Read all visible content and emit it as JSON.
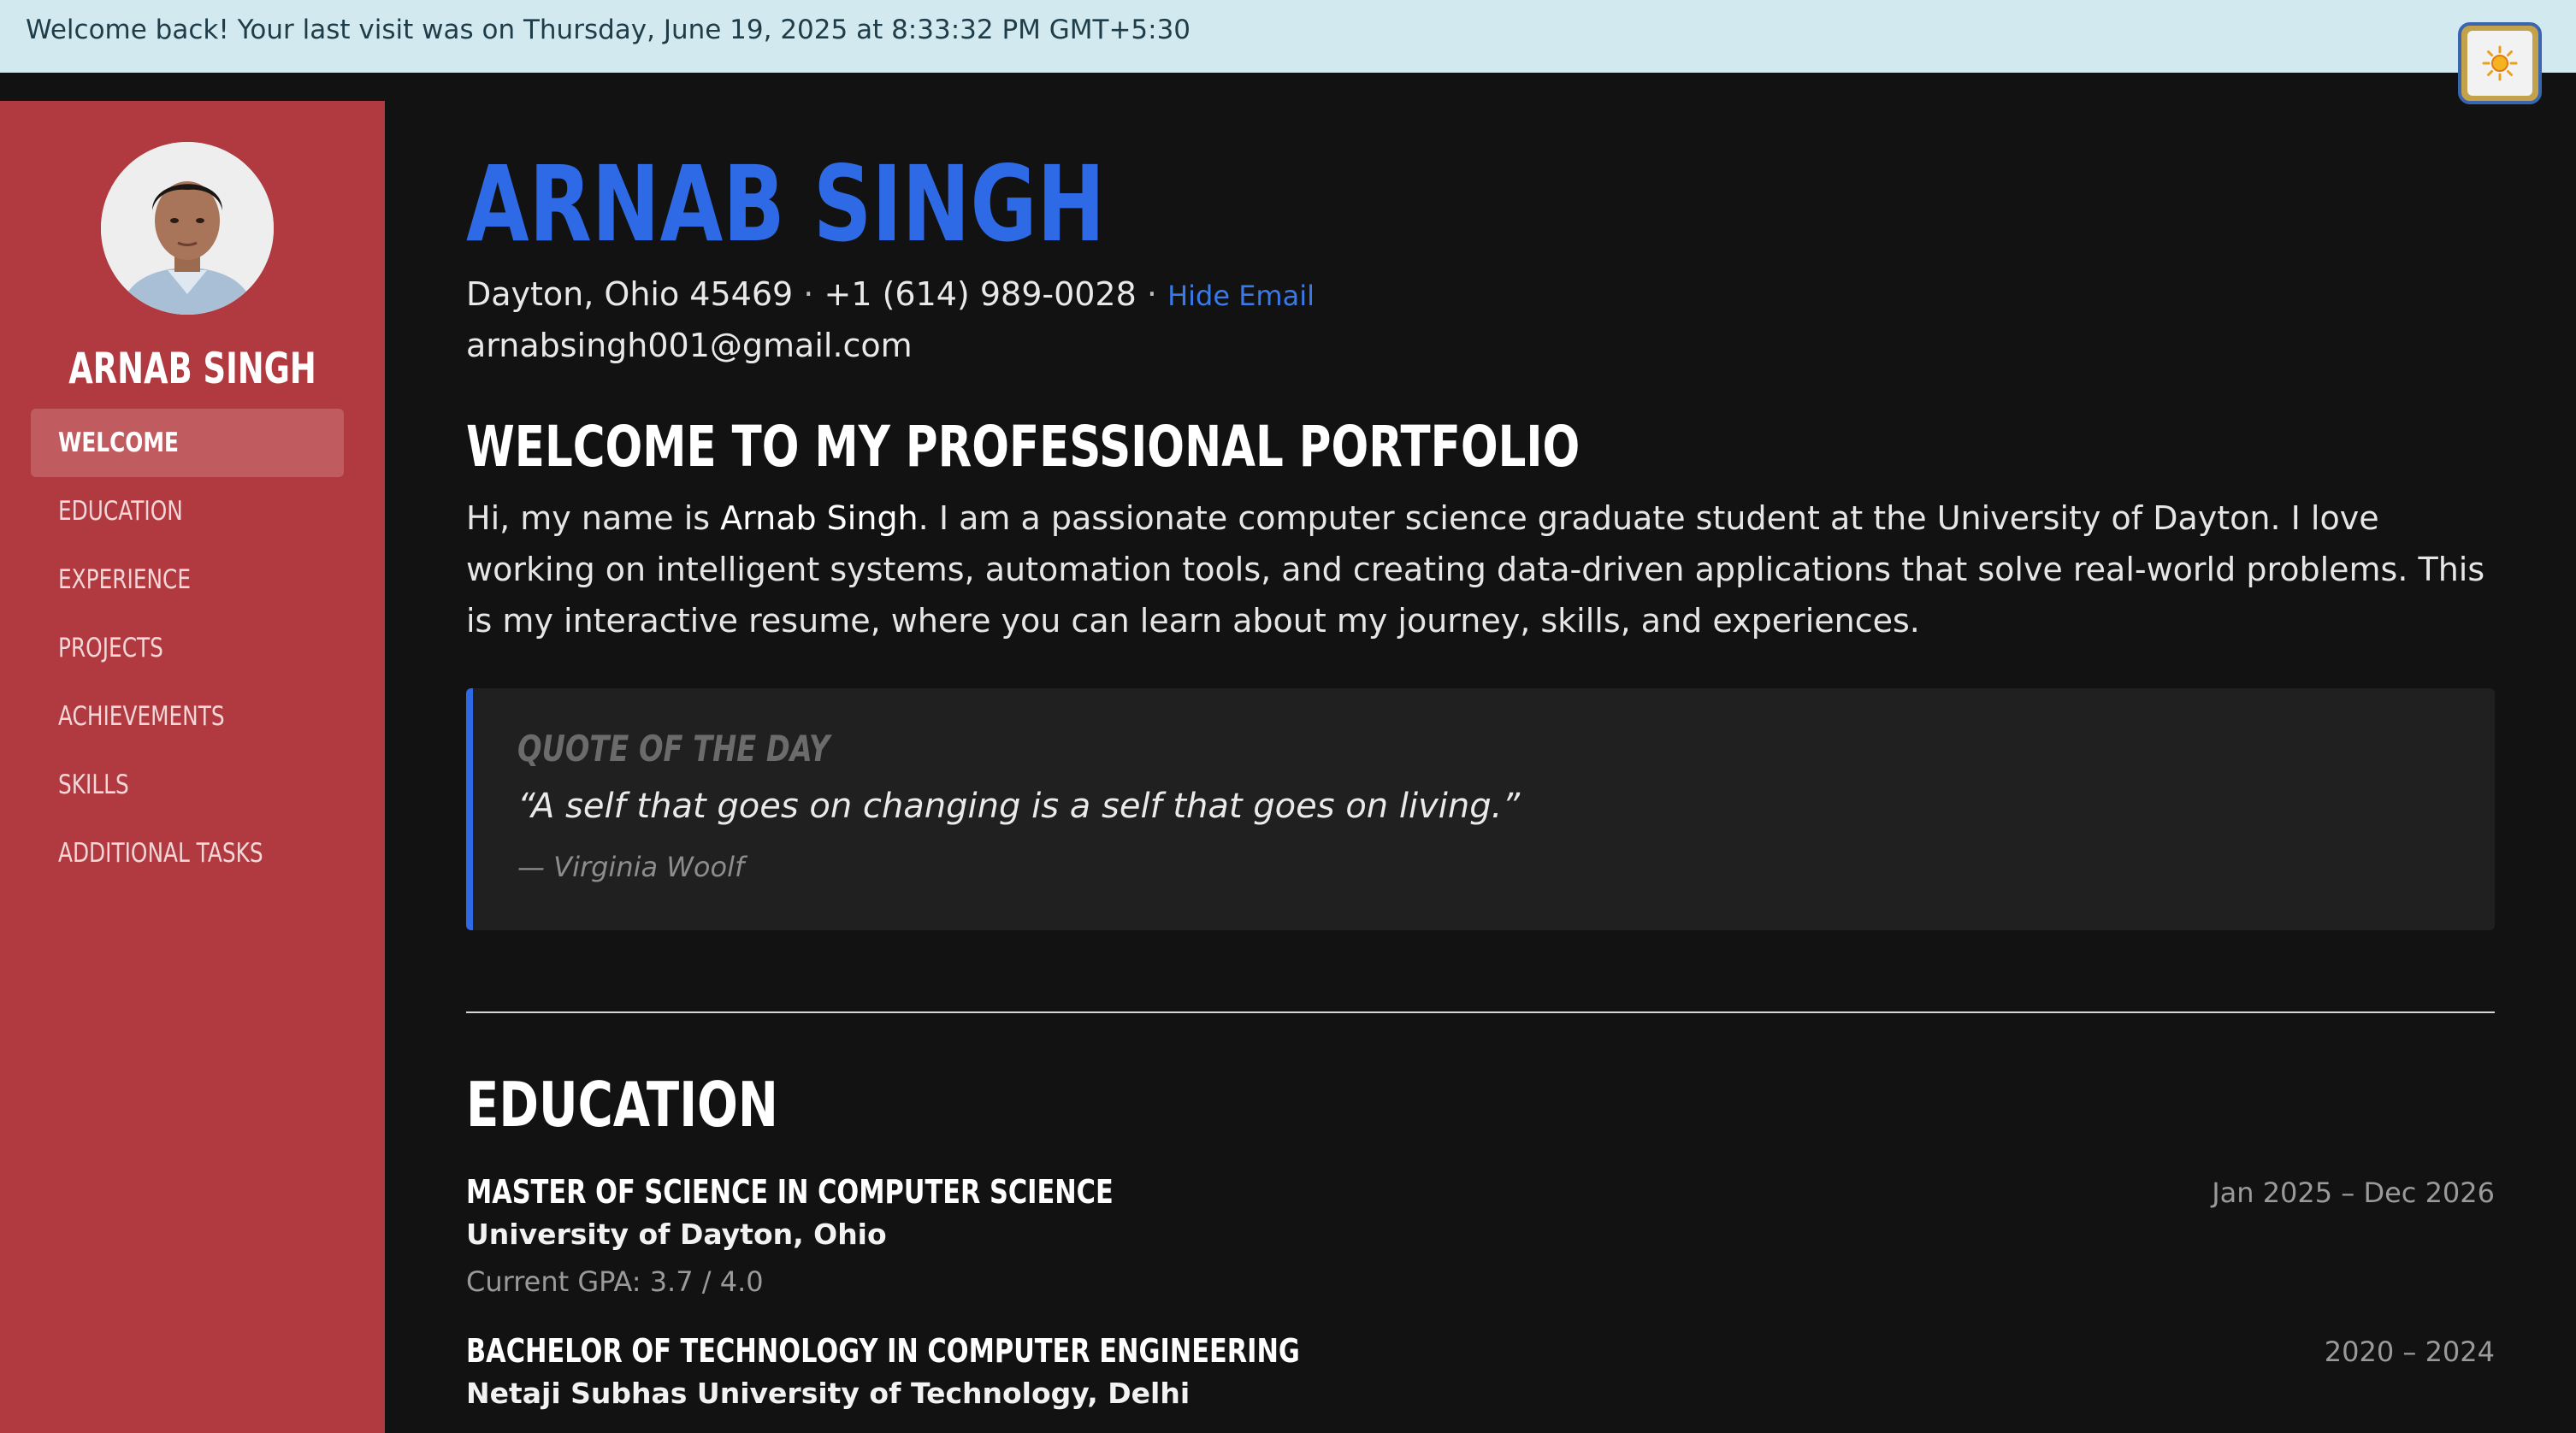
{
  "banner": {
    "text": "Welcome back! Your last visit was on Thursday, June 19, 2025 at 8:33:32 PM GMT+5:30",
    "theme_toggle_icon": "sun-icon"
  },
  "sidebar": {
    "name": "ARNAB SINGH",
    "avatar_alt": "profile-photo",
    "items": [
      {
        "label": "Welcome",
        "active": true
      },
      {
        "label": "Education",
        "active": false
      },
      {
        "label": "Experience",
        "active": false
      },
      {
        "label": "Projects",
        "active": false
      },
      {
        "label": "Achievements",
        "active": false
      },
      {
        "label": "Skills",
        "active": false
      },
      {
        "label": "Additional Tasks",
        "active": false
      }
    ]
  },
  "header": {
    "name": "ARNAB SINGH",
    "location": "Dayton, Ohio 45469",
    "separator": "·",
    "phone": "+1 (614) 989-0028",
    "hide_email_label": "Hide Email",
    "email": "arnabsingh001@gmail.com"
  },
  "welcome": {
    "title": "WELCOME TO MY PROFESSIONAL PORTFOLIO",
    "intro_prefix": "Hi, my name is ",
    "intro_name": "Arnab Singh",
    "intro_rest": ". I am a passionate computer science graduate student at the University of Dayton. I love working on intelligent systems, automation tools, and creating data-driven applications that solve real-world problems. This is my interactive resume, where you can learn about my journey, skills, and experiences."
  },
  "quote": {
    "label": "Quote of the Day",
    "text": "“A self that goes on changing is a self that goes on living.”",
    "author": "— Virginia Woolf"
  },
  "education": {
    "title": "EDUCATION",
    "items": [
      {
        "degree": "Master of Science in Computer Science",
        "dates": "Jan 2025 – Dec 2026",
        "school": "University of Dayton, Ohio",
        "gpa": "Current GPA: 3.7 / 4.0"
      },
      {
        "degree": "Bachelor of Technology in Computer Engineering",
        "dates": "2020 – 2024",
        "school": "Netaji Subhas University of Technology, Delhi"
      }
    ]
  },
  "colors": {
    "sidebar": "#b03a40",
    "accent": "#2f6ae6",
    "background": "#121212",
    "banner": "#d2e9ef"
  }
}
